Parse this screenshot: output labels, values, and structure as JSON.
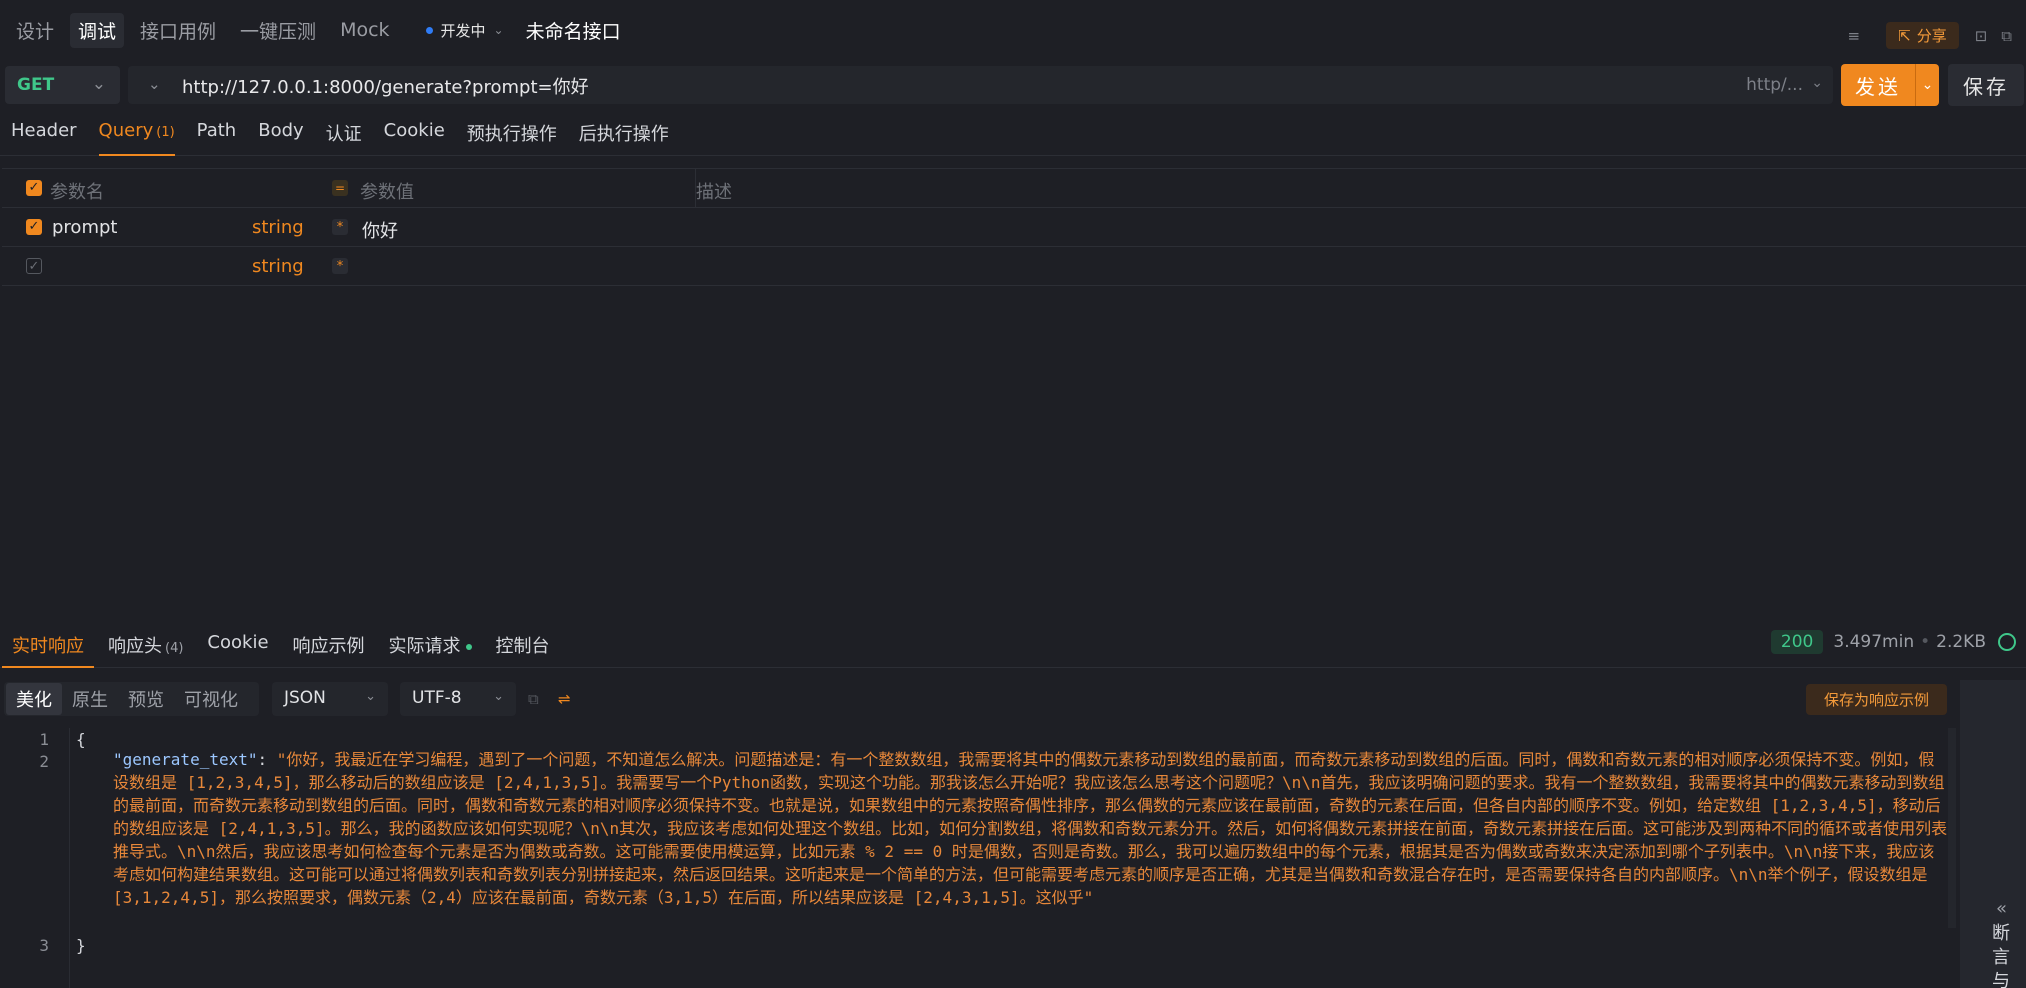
{
  "top_tabs": [
    "设计",
    "调试",
    "接口用例",
    "一键压测",
    "Mock"
  ],
  "active_top_tab": "调试",
  "dev_status": "开发中",
  "api_title": "未命名接口",
  "share_label": "分享",
  "request": {
    "method": "GET",
    "url": "http://127.0.0.1:8000/generate?prompt=你好",
    "environment": "http/...",
    "send_label": "发送",
    "save_label": "保存"
  },
  "request_tabs": [
    {
      "label": "Header",
      "count": ""
    },
    {
      "label": "Query",
      "count": "(1)"
    },
    {
      "label": "Path",
      "count": ""
    },
    {
      "label": "Body",
      "count": ""
    },
    {
      "label": "认证",
      "count": ""
    },
    {
      "label": "Cookie",
      "count": ""
    },
    {
      "label": "预执行操作",
      "count": ""
    },
    {
      "label": "后执行操作",
      "count": ""
    }
  ],
  "params_table": {
    "headers": {
      "name": "参数名",
      "value": "参数值",
      "description": "描述"
    },
    "rows": [
      {
        "name": "prompt",
        "type": "string",
        "value": "你好",
        "checked": true
      },
      {
        "name": "",
        "type": "string",
        "value": "",
        "checked": false
      }
    ]
  },
  "response_tabs": [
    {
      "label": "实时响应",
      "count": ""
    },
    {
      "label": "响应头",
      "count": "(4)"
    },
    {
      "label": "Cookie",
      "count": ""
    },
    {
      "label": "响应示例",
      "count": ""
    },
    {
      "label": "实际请求",
      "count": ""
    },
    {
      "label": "控制台",
      "count": ""
    }
  ],
  "response_meta": {
    "status": "200",
    "time": "3.497min",
    "size": "2.2KB"
  },
  "view_modes": [
    "美化",
    "原生",
    "预览",
    "可视化"
  ],
  "format": "JSON",
  "encoding": "UTF-8",
  "save_example_label": "保存为响应示例",
  "side_panel_label": "断言与",
  "response_json": {
    "open": "{",
    "key": "\"generate_text\"",
    "colon": ": ",
    "value": "\"你好，我最近在学习编程，遇到了一个问题，不知道怎么解决。问题描述是：有一个整数数组，我需要将其中的偶数元素移动到数组的最前面，而奇数元素移动到数组的后面。同时，偶数和奇数元素的相对顺序必须保持不变。例如，假设数组是 [1,2,3,4,5]，那么移动后的数组应该是 [2,4,1,3,5]。我需要写一个Python函数，实现这个功能。那我该怎么开始呢？我应该怎么思考这个问题呢？\\n\\n首先，我应该明确问题的要求。我有一个整数数组，我需要将其中的偶数元素移动到数组的最前面，而奇数元素移动到数组的后面。同时，偶数和奇数元素的相对顺序必须保持不变。也就是说，如果数组中的元素按照奇偶性排序，那么偶数的元素应该在最前面，奇数的元素在后面，但各自内部的顺序不变。例如，给定数组 [1,2,3,4,5]，移动后的数组应该是 [2,4,1,3,5]。那么，我的函数应该如何实现呢？\\n\\n其次，我应该考虑如何处理这个数组。比如，如何分割数组，将偶数和奇数元素分开。然后，如何将偶数元素拼接在前面，奇数元素拼接在后面。这可能涉及到两种不同的循环或者使用列表推导式。\\n\\n然后，我应该思考如何检查每个元素是否为偶数或奇数。这可能需要使用模运算，比如元素 % 2 == 0 时是偶数，否则是奇数。那么，我可以遍历数组中的每个元素，根据其是否为偶数或奇数来决定添加到哪个子列表中。\\n\\n接下来，我应该考虑如何构建结果数组。这可能可以通过将偶数列表和奇数列表分别拼接起来，然后返回结果。这听起来是一个简单的方法，但可能需要考虑元素的顺序是否正确，尤其是当偶数和奇数混合存在时，是否需要保持各自的内部顺序。\\n\\n举个例子，假设数组是 [3,1,2,4,5]，那么按照要求，偶数元素（2,4）应该在最前面，奇数元素（3,1,5）在后面，所以结果应该是 [2,4,3,1,5]。这似乎\"",
    "close": "}",
    "line_numbers": [
      "1",
      "2",
      "3"
    ]
  }
}
